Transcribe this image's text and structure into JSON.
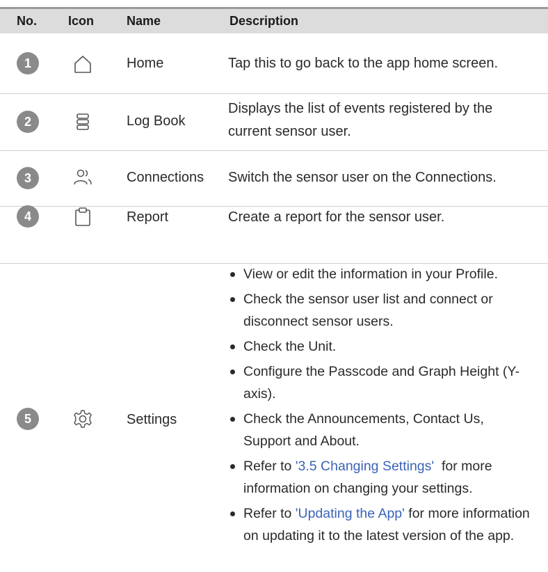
{
  "header": {
    "no": "No.",
    "icon": "Icon",
    "name": "Name",
    "description": "Description"
  },
  "rows": [
    {
      "num": "1",
      "icon": "home-icon",
      "name": "Home",
      "description": "Tap this to go back to the app home screen."
    },
    {
      "num": "2",
      "icon": "log-book-icon",
      "name": "Log Book",
      "description": "Displays the list of events registered by the current sensor user."
    },
    {
      "num": "3",
      "icon": "connections-icon",
      "name": "Connections",
      "description": "Switch the sensor user on the Connections."
    },
    {
      "num": "4",
      "icon": "report-icon",
      "name": "Report",
      "description": "Create a report for the sensor user."
    },
    {
      "num": "5",
      "icon": "settings-icon",
      "name": "Settings",
      "bullets": [
        "View or edit the information in your Profile.",
        "Check the sensor user list and connect or disconnect sensor users.",
        "Check the Unit.",
        "Configure the Passcode and Graph Height (Y-axis).",
        "Check the Announcements, Contact Us, Support and About."
      ],
      "link_bullets": [
        {
          "prefix": "Refer to ",
          "link": "'3.5 Changing Settings'",
          "suffix": "  for more information on changing your settings."
        },
        {
          "prefix": "Refer to ",
          "link": "'Updating the App'",
          "suffix": " for more information on updating it to the latest version of the app."
        }
      ]
    }
  ],
  "colors": {
    "header_bg": "#dcdcdc",
    "badge": "#8a8a8a",
    "link": "#3b63b8",
    "divider": "#cfcfcf"
  }
}
